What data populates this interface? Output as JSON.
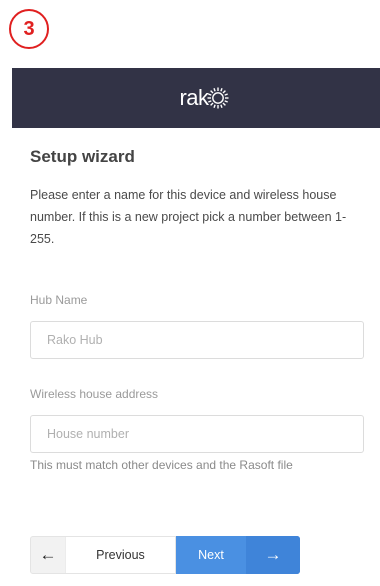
{
  "step_badge": "3",
  "header": {
    "logo_text": "rak",
    "logo_icon": "starburst-o-icon",
    "background": "#323346"
  },
  "wizard": {
    "title": "Setup wizard",
    "description": "Please enter a name for this device and wireless house number. If this is a new project pick a number between 1-255."
  },
  "hub_name": {
    "label": "Hub Name",
    "placeholder": "Rako Hub",
    "value": ""
  },
  "house_address": {
    "label": "Wireless house address",
    "placeholder": "House number",
    "value": "",
    "help": "This must match other devices and the Rasoft file"
  },
  "buttons": {
    "previous_label": "Previous",
    "previous_icon": "arrow-left-icon",
    "next_label": "Next",
    "next_icon": "arrow-right-icon",
    "next_color": "#4a90e2"
  },
  "colors": {
    "step_badge": "#e02020",
    "accent": "#4a90e2"
  }
}
